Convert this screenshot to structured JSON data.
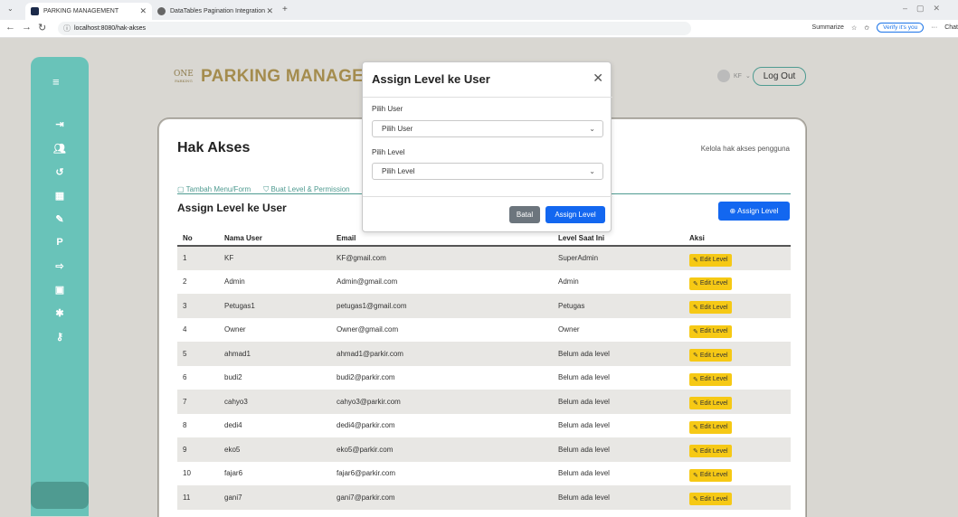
{
  "browser": {
    "tabs": [
      {
        "label": "PARKING MANAGEMENT"
      },
      {
        "label": "DataTables Pagination Integration"
      }
    ],
    "url": "localhost:8080/hak-akses",
    "summarize_label": "Summarize",
    "verify_label": "Verify it's you",
    "chat_label": "Chat"
  },
  "header": {
    "logo_line1": "ONE",
    "logo_line2": "PARKING",
    "title": "PARKING MANAGEMENT",
    "user_initials": "KF",
    "logout_label": "Log Out"
  },
  "page": {
    "title": "Hak Akses",
    "subtitle": "Kelola hak akses pengguna",
    "tabs": [
      {
        "label": "Tambah Menu/Form"
      },
      {
        "label": "Buat Level & Permission"
      }
    ],
    "section_title": "Assign Level ke User",
    "assign_button": "Assign Level"
  },
  "table": {
    "headers": [
      "No",
      "Nama User",
      "Email",
      "Level Saat Ini",
      "Aksi"
    ],
    "edit_label": "Edit Level",
    "rows": [
      {
        "no": "1",
        "name": "KF",
        "email": "KF@gmail.com",
        "level": "SuperAdmin"
      },
      {
        "no": "2",
        "name": "Admin",
        "email": "Admin@gmail.com",
        "level": "Admin"
      },
      {
        "no": "3",
        "name": "Petugas1",
        "email": "petugas1@gmail.com",
        "level": "Petugas"
      },
      {
        "no": "4",
        "name": "Owner",
        "email": "Owner@gmail.com",
        "level": "Owner"
      },
      {
        "no": "5",
        "name": "ahmad1",
        "email": "ahmad1@parkir.com",
        "level": "Belum ada level"
      },
      {
        "no": "6",
        "name": "budi2",
        "email": "budi2@parkir.com",
        "level": "Belum ada level"
      },
      {
        "no": "7",
        "name": "cahyo3",
        "email": "cahyo3@parkir.com",
        "level": "Belum ada level"
      },
      {
        "no": "8",
        "name": "dedi4",
        "email": "dedi4@parkir.com",
        "level": "Belum ada level"
      },
      {
        "no": "9",
        "name": "eko5",
        "email": "eko5@parkir.com",
        "level": "Belum ada level"
      },
      {
        "no": "10",
        "name": "fajar6",
        "email": "fajar6@parkir.com",
        "level": "Belum ada level"
      },
      {
        "no": "11",
        "name": "gani7",
        "email": "gani7@parkir.com",
        "level": "Belum ada level"
      }
    ]
  },
  "modal": {
    "title": "Assign Level ke User",
    "user_label": "Pilih User",
    "user_placeholder": "Pilih User",
    "level_label": "Pilih Level",
    "level_placeholder": "Pilih Level",
    "cancel_label": "Batal",
    "submit_label": "Assign Level"
  },
  "colors": {
    "sidebar": "#69c3b9",
    "brand": "#a48c4e",
    "primary": "#1367f0",
    "warning": "#f6c915"
  }
}
